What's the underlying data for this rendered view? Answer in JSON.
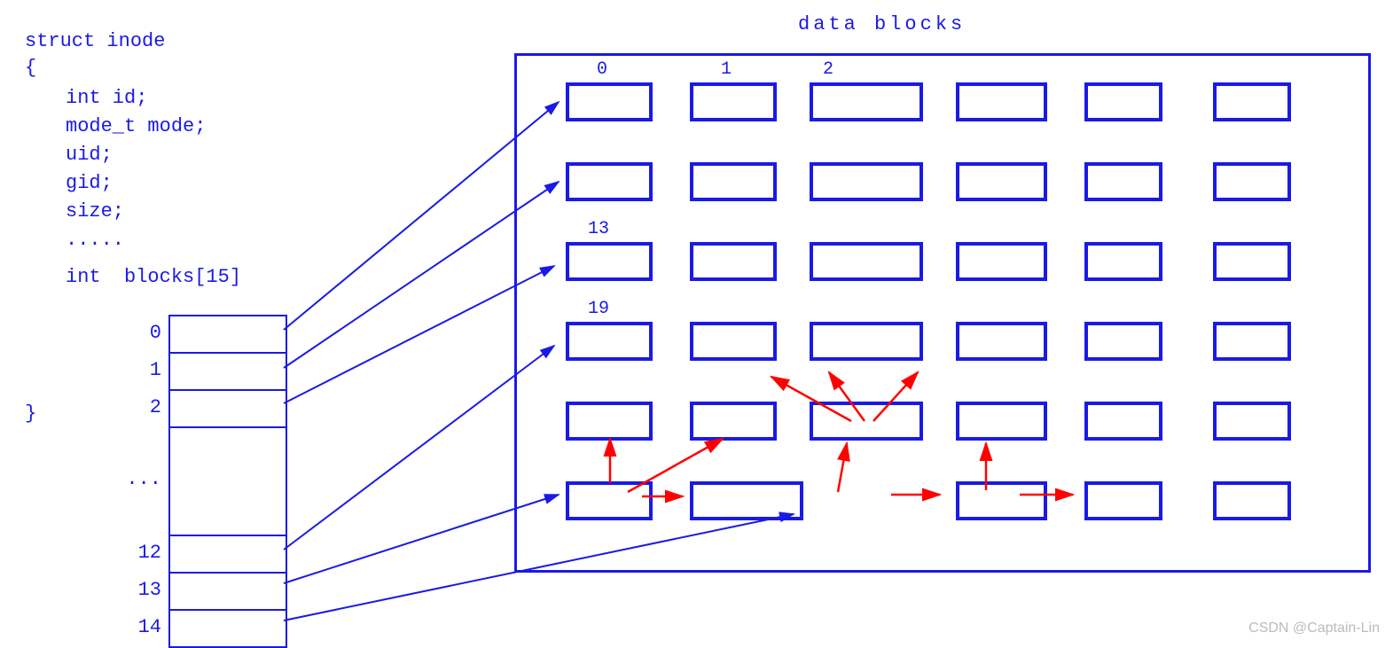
{
  "code": {
    "l1": "struct inode",
    "l2": "{",
    "l3": "int id;",
    "l4": "mode_t mode;",
    "l5": "uid;",
    "l6": "gid;",
    "l7": "size;",
    "l8": ".....",
    "l9": "int  blocks[15]",
    "l10": "}"
  },
  "array": {
    "i0": "0",
    "i1": "1",
    "i2": "2",
    "dots": "...",
    "i12": "12",
    "i13": "13",
    "i14": "14"
  },
  "title": "data  blocks",
  "blklabels": {
    "b0": "0",
    "b1": "1",
    "b2": "2",
    "b13": "13",
    "b19": "19"
  },
  "watermark": "CSDN @Captain-Lin"
}
